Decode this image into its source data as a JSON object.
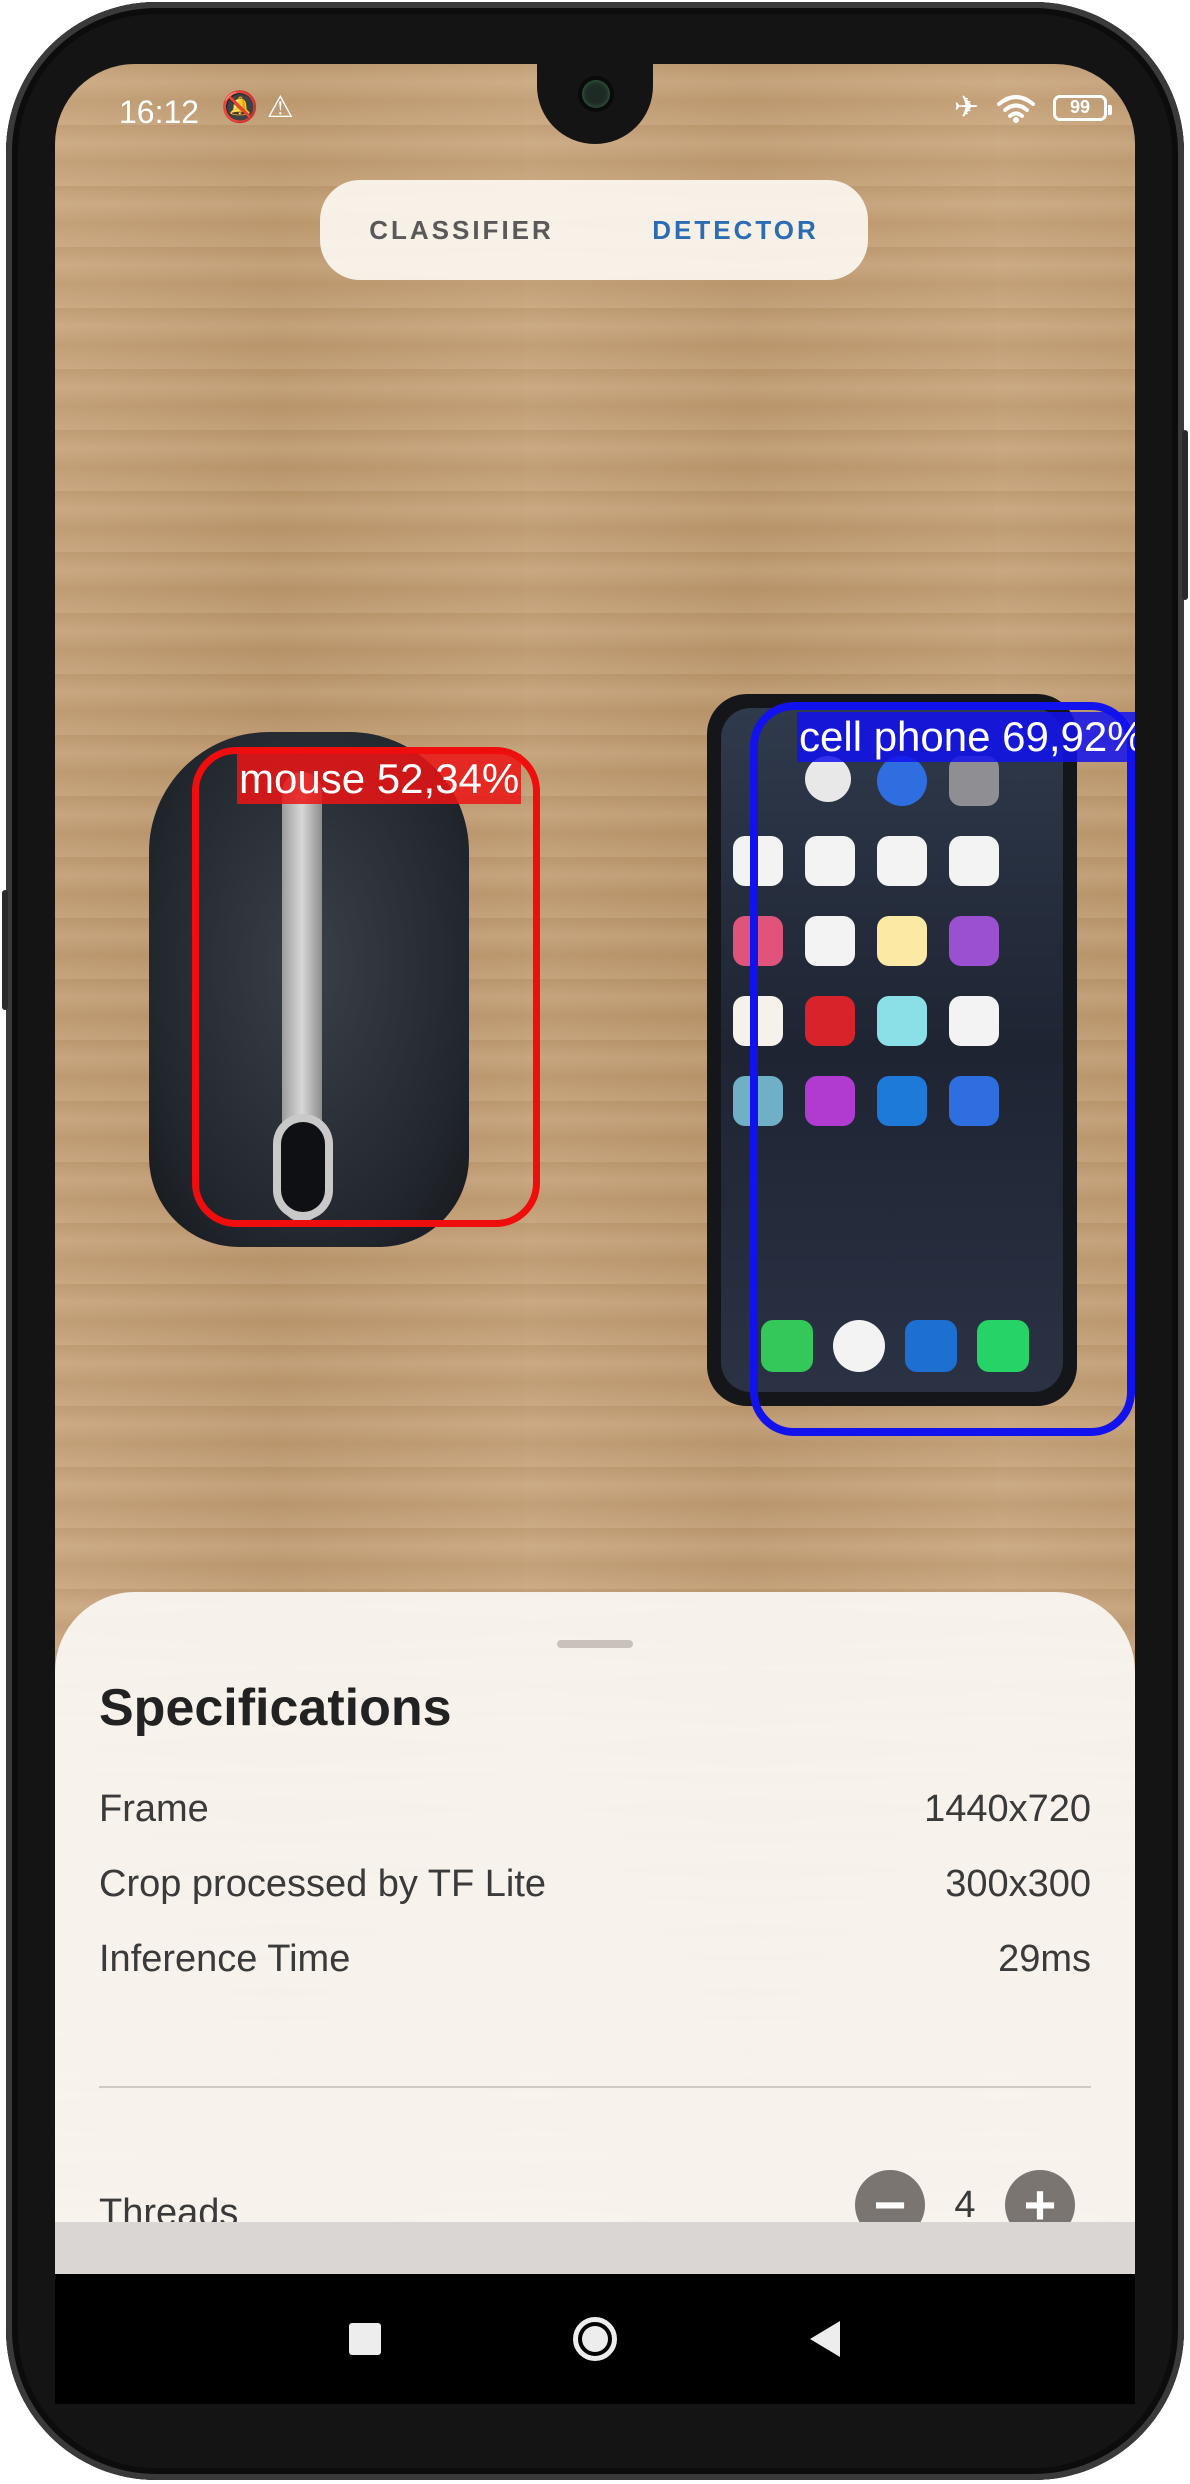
{
  "status_bar": {
    "time": "16:12",
    "left_icons": [
      "mute-icon",
      "warning-icon"
    ],
    "right_icons": [
      "airplane-icon",
      "wifi-icon"
    ],
    "battery": "99"
  },
  "tabs": [
    {
      "label": "CLASSIFIER",
      "active": false
    },
    {
      "label": "DETECTOR",
      "active": true
    }
  ],
  "detections": [
    {
      "label": "mouse 52,34%",
      "color": "#ef0d0d"
    },
    {
      "label": "cell phone 69,92%",
      "color": "#1212ee"
    }
  ],
  "specs": {
    "title": "Specifications",
    "rows": [
      {
        "label": "Frame",
        "value": "1440x720"
      },
      {
        "label": "Crop processed by TF Lite",
        "value": "300x300"
      },
      {
        "label": "Inference Time",
        "value": "29ms"
      }
    ],
    "threads": {
      "label": "Threads",
      "value": "4",
      "minus": "−",
      "plus": "+"
    }
  },
  "colors": {
    "accent": "#2b6cb5",
    "tab_inactive": "#595959"
  }
}
